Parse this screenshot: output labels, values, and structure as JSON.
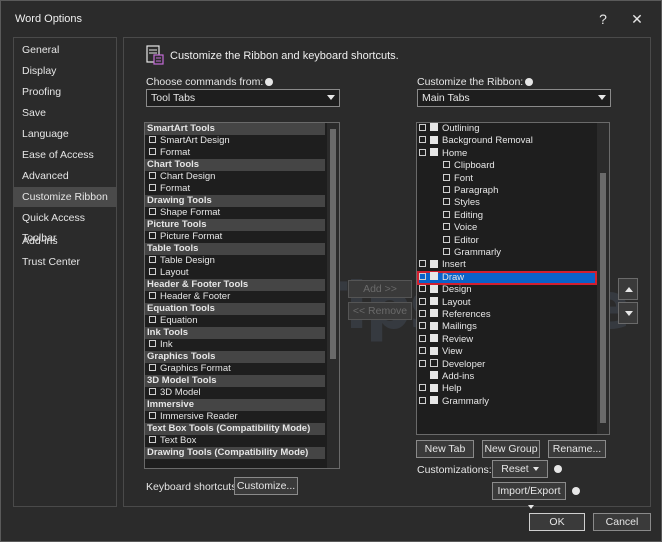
{
  "window": {
    "title": "Word Options",
    "help": "?",
    "close": "✕"
  },
  "nav": {
    "items": [
      "General",
      "Display",
      "Proofing",
      "Save",
      "Language",
      "Ease of Access",
      "Advanced",
      "Customize Ribbon",
      "Quick Access Toolbar",
      "Add-ins",
      "Trust Center"
    ],
    "active_index": 7
  },
  "header": {
    "text": "Customize the Ribbon and keyboard shortcuts."
  },
  "left": {
    "choose_label": "Choose commands from:",
    "choose_value": "Tool Tabs",
    "rows": [
      {
        "type": "group",
        "text": "SmartArt Tools"
      },
      {
        "type": "item",
        "text": "SmartArt Design"
      },
      {
        "type": "item",
        "text": "Format"
      },
      {
        "type": "group",
        "text": "Chart Tools"
      },
      {
        "type": "item",
        "text": "Chart Design"
      },
      {
        "type": "item",
        "text": "Format"
      },
      {
        "type": "group",
        "text": "Drawing Tools"
      },
      {
        "type": "item",
        "text": "Shape Format"
      },
      {
        "type": "group",
        "text": "Picture Tools"
      },
      {
        "type": "item",
        "text": "Picture Format"
      },
      {
        "type": "group",
        "text": "Table Tools"
      },
      {
        "type": "item",
        "text": "Table Design"
      },
      {
        "type": "item",
        "text": "Layout"
      },
      {
        "type": "group",
        "text": "Header & Footer Tools"
      },
      {
        "type": "item",
        "text": "Header & Footer"
      },
      {
        "type": "group",
        "text": "Equation Tools"
      },
      {
        "type": "item",
        "text": "Equation"
      },
      {
        "type": "group",
        "text": "Ink Tools"
      },
      {
        "type": "item",
        "text": "Ink"
      },
      {
        "type": "group",
        "text": "Graphics Tools"
      },
      {
        "type": "item",
        "text": "Graphics Format"
      },
      {
        "type": "group",
        "text": "3D Model Tools"
      },
      {
        "type": "item",
        "text": "3D Model"
      },
      {
        "type": "group",
        "text": "Immersive"
      },
      {
        "type": "item",
        "text": "Immersive Reader"
      },
      {
        "type": "group",
        "text": "Text Box Tools (Compatibility Mode)"
      },
      {
        "type": "item",
        "text": "Text Box"
      },
      {
        "type": "group",
        "text": "Drawing Tools (Compatibility Mode)"
      }
    ]
  },
  "middle": {
    "add_label": "Add >>",
    "remove_label": "<< Remove"
  },
  "right": {
    "customize_label": "Customize the Ribbon:",
    "customize_value": "Main Tabs",
    "rows": [
      {
        "level": 0,
        "checked": true,
        "text": "Outlining"
      },
      {
        "level": 0,
        "checked": true,
        "text": "Background Removal"
      },
      {
        "level": 0,
        "checked": true,
        "text": "Home",
        "expanded": true
      },
      {
        "level": 1,
        "text": "Clipboard"
      },
      {
        "level": 1,
        "text": "Font"
      },
      {
        "level": 1,
        "text": "Paragraph"
      },
      {
        "level": 1,
        "text": "Styles"
      },
      {
        "level": 1,
        "text": "Editing"
      },
      {
        "level": 1,
        "text": "Voice"
      },
      {
        "level": 1,
        "text": "Editor"
      },
      {
        "level": 1,
        "text": "Grammarly"
      },
      {
        "level": 0,
        "checked": true,
        "text": "Insert"
      },
      {
        "level": 0,
        "checked": true,
        "text": "Draw",
        "selected": true
      },
      {
        "level": 0,
        "checked": true,
        "text": "Design"
      },
      {
        "level": 0,
        "checked": true,
        "text": "Layout"
      },
      {
        "level": 0,
        "checked": true,
        "text": "References"
      },
      {
        "level": 0,
        "checked": true,
        "text": "Mailings"
      },
      {
        "level": 0,
        "checked": true,
        "text": "Review"
      },
      {
        "level": 0,
        "checked": true,
        "text": "View"
      },
      {
        "level": 0,
        "checked": false,
        "text": "Developer"
      },
      {
        "level": 0,
        "checked": true,
        "text": "Add-ins",
        "noexpand": true
      },
      {
        "level": 0,
        "checked": true,
        "text": "Help"
      },
      {
        "level": 0,
        "checked": true,
        "text": "Grammarly"
      }
    ],
    "new_tab": "New Tab",
    "new_group": "New Group",
    "rename": "Rename...",
    "customizations_label": "Customizations:",
    "reset": "Reset",
    "import_export": "Import/Export"
  },
  "keyboard": {
    "label": "Keyboard shortcuts:",
    "button": "Customize..."
  },
  "footer": {
    "ok": "OK",
    "cancel": "Cancel"
  },
  "watermark": "TipsMake"
}
